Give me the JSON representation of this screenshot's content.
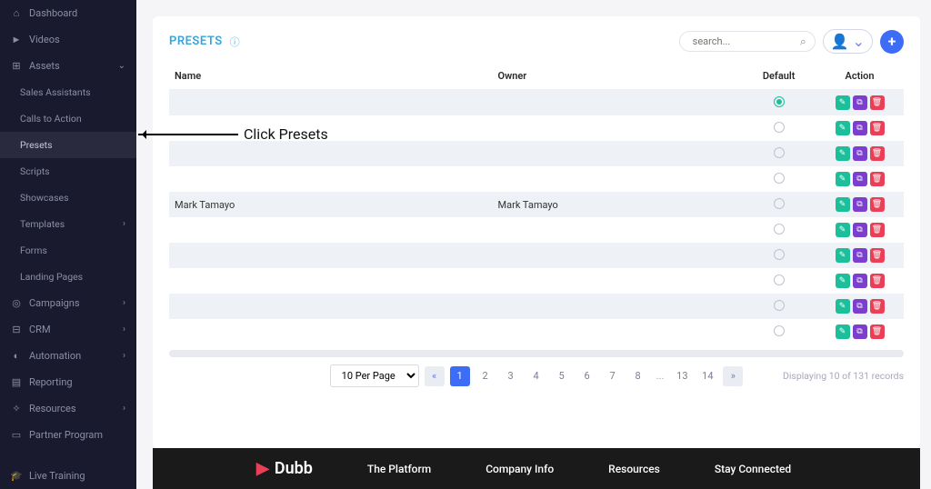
{
  "sidebar": {
    "items": [
      {
        "label": "Dashboard",
        "icon": "⌂"
      },
      {
        "label": "Videos",
        "icon": "►"
      },
      {
        "label": "Assets",
        "icon": "⊞",
        "chevron": "⌄",
        "expanded": true
      },
      {
        "label": "Sales Assistants",
        "sub": true
      },
      {
        "label": "Calls to Action",
        "sub": true
      },
      {
        "label": "Presets",
        "sub": true,
        "active": true
      },
      {
        "label": "Scripts",
        "sub": true
      },
      {
        "label": "Showcases",
        "sub": true
      },
      {
        "label": "Templates",
        "sub": true,
        "chevron": "›"
      },
      {
        "label": "Forms",
        "sub": true
      },
      {
        "label": "Landing Pages",
        "sub": true
      },
      {
        "label": "Campaigns",
        "icon": "◎",
        "chevron": "›"
      },
      {
        "label": "CRM",
        "icon": "⊟",
        "chevron": "›"
      },
      {
        "label": "Automation",
        "icon": "◐",
        "chevron": "›"
      },
      {
        "label": "Reporting",
        "icon": "▤"
      },
      {
        "label": "Resources",
        "icon": "✧",
        "chevron": "›"
      },
      {
        "label": "Partner Program",
        "icon": "▭"
      }
    ],
    "bottom": {
      "label": "Live Training",
      "icon": "🎓"
    }
  },
  "header": {
    "title": "PRESETS",
    "search_placeholder": "search..."
  },
  "table": {
    "columns": {
      "name": "Name",
      "owner": "Owner",
      "default": "Default",
      "action": "Action"
    },
    "rows": [
      {
        "name": "",
        "owner": "",
        "default": true
      },
      {
        "name": "",
        "owner": "",
        "default": false
      },
      {
        "name": "",
        "owner": "",
        "default": false
      },
      {
        "name": "",
        "owner": "",
        "default": false
      },
      {
        "name": "Mark Tamayo",
        "owner": "Mark Tamayo",
        "default": false
      },
      {
        "name": "",
        "owner": "",
        "default": false
      },
      {
        "name": "",
        "owner": "",
        "default": false
      },
      {
        "name": "",
        "owner": "",
        "default": false
      },
      {
        "name": "",
        "owner": "",
        "default": false
      },
      {
        "name": "",
        "owner": "",
        "default": false
      }
    ]
  },
  "pagination": {
    "per_page": "10 Per Page",
    "pages": [
      "1",
      "2",
      "3",
      "4",
      "5",
      "6",
      "7",
      "8"
    ],
    "ellipsis": "...",
    "last_pages": [
      "13",
      "14"
    ],
    "records_info": "Displaying 10 of 131 records"
  },
  "footer": {
    "brand": "Dubb",
    "cols": [
      "The Platform",
      "Company Info",
      "Resources",
      "Stay Connected"
    ]
  },
  "annotation": {
    "text": "Click Presets"
  }
}
